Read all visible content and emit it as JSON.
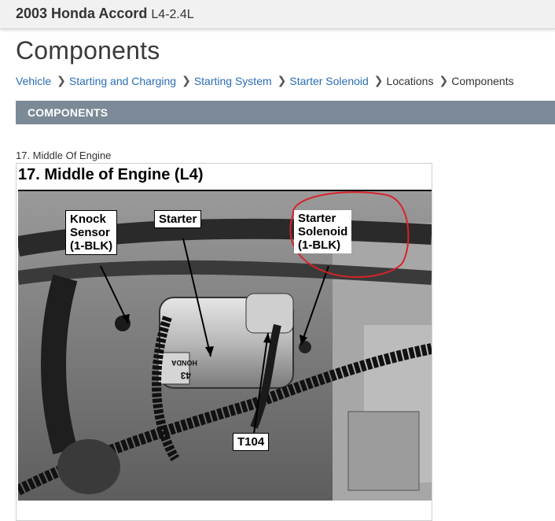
{
  "header": {
    "vehicle_name": "2003 Honda Accord",
    "engine": "L4-2.4L"
  },
  "page": {
    "title": "Components"
  },
  "breadcrumb": [
    {
      "label": "Vehicle",
      "link": true
    },
    {
      "label": "Starting and Charging",
      "link": true
    },
    {
      "label": "Starting System",
      "link": true
    },
    {
      "label": "Starter Solenoid",
      "link": true
    },
    {
      "label": "Locations",
      "link": false
    },
    {
      "label": "Components",
      "link": false
    }
  ],
  "section": {
    "header": "COMPONENTS"
  },
  "figure": {
    "caption": "17. Middle Of Engine",
    "heading": "17. Middle of Engine (L4)",
    "callouts": {
      "knock_sensor": "Knock\nSensor\n(1-BLK)",
      "starter": "Starter",
      "starter_solenoid": "Starter\nSolenoid\n(1-BLK)",
      "t104": "T104"
    },
    "markings": {
      "starter_body": "HONDA",
      "starter_number": "43"
    }
  },
  "colors": {
    "link": "#2a6db5",
    "section_bar": "#7b8a96",
    "annotation_circle": "#d8232a"
  }
}
